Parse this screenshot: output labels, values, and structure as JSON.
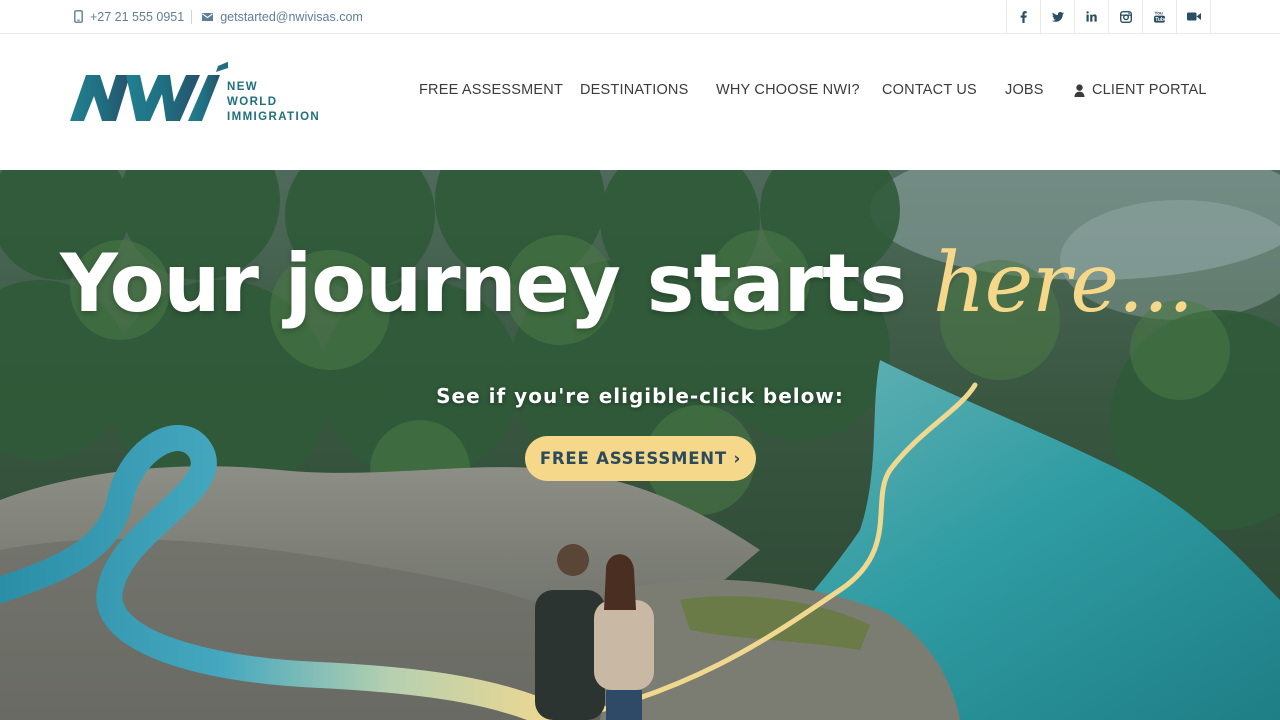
{
  "topbar": {
    "phone": "+27 21 555 0951",
    "email": "getstarted@nwivisas.com",
    "phone_icon": "mobile-phone-icon",
    "email_icon": "envelope-icon",
    "social": [
      {
        "name": "facebook-icon"
      },
      {
        "name": "twitter-icon"
      },
      {
        "name": "linkedin-icon"
      },
      {
        "name": "instagram-icon"
      },
      {
        "name": "youtube-icon"
      },
      {
        "name": "video-camera-icon"
      }
    ]
  },
  "logo": {
    "line1": "NEW",
    "line2": "WORLD",
    "line3": "IMMIGRATION"
  },
  "nav": {
    "items": [
      "FREE ASSESSMENT",
      "DESTINATIONS",
      "WHY CHOOSE NWI?",
      "CONTACT US",
      "JOBS",
      "CLIENT PORTAL"
    ],
    "portal_icon": "user-icon"
  },
  "hero": {
    "headline_main": "Your journey starts ",
    "headline_accent": "here...",
    "subheadline": "See if you're eligible-click below:",
    "cta_label": "FREE ASSESSMENT ›"
  },
  "colors": {
    "brand_teal": "#1f6f7f",
    "accent_yellow": "#f5d88a",
    "text_blue_grey": "#5f7f95",
    "cta_text": "#2b4a5c"
  }
}
